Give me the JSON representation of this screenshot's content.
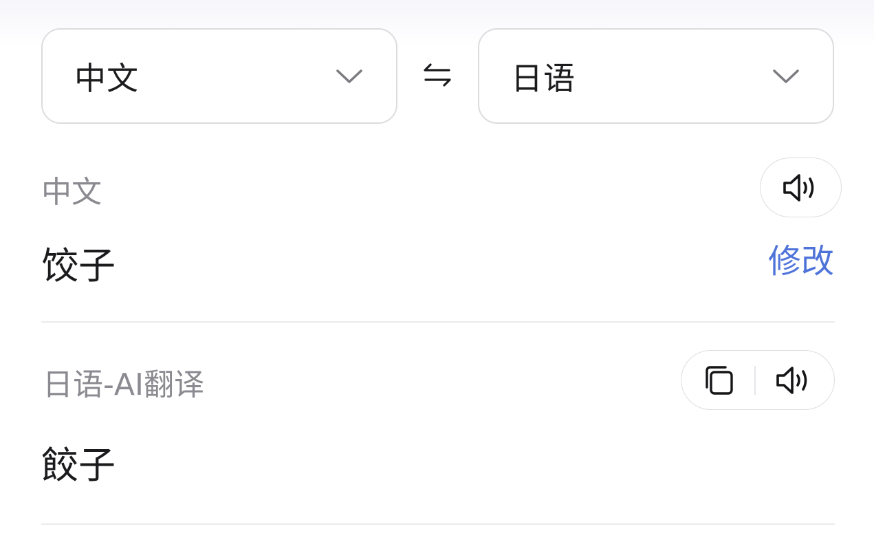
{
  "language_bar": {
    "source_language": "中文",
    "target_language": "日语"
  },
  "source": {
    "label": "中文",
    "text": "饺子",
    "edit_label": "修改"
  },
  "result": {
    "label": "日语-AI翻译",
    "text": "餃子"
  },
  "colors": {
    "accent": "#4f74d9",
    "muted_label": "#8a8a90",
    "border": "#dcdcdf"
  },
  "icons": {
    "swap": "swap-arrows-icon",
    "dropdown": "chevron-down-icon",
    "speaker": "speaker-icon",
    "copy": "copy-icon"
  }
}
